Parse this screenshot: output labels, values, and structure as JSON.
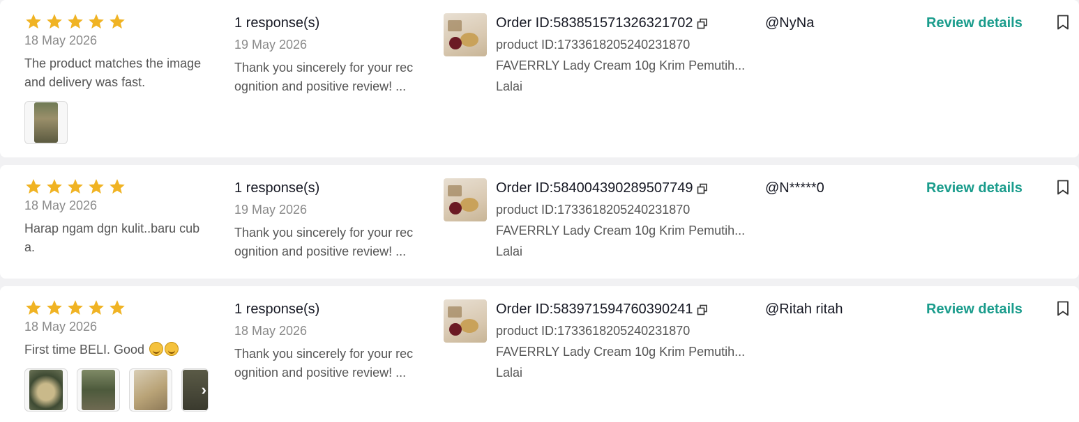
{
  "colors": {
    "star": "#f0b323",
    "accent": "#1a9c8c"
  },
  "icons": {
    "star": "star-icon",
    "copy": "copy-icon",
    "bookmark": "bookmark-icon"
  },
  "reviews": [
    {
      "rating": 5,
      "date": "18 May 2026",
      "comment": "The product matches the image and delivery was fast.",
      "photo_count": 1,
      "response_count": "1 response(s)",
      "response_date": "19 May 2026",
      "response_text": "Thank you sincerely for your rec ognition and positive review! ...",
      "order_id": "Order ID:583851571326321702",
      "product_id": "product ID:1733618205240231870",
      "product_name": "FAVERRLY Lady Cream 10g Krim Pemutih...",
      "variant": "Lalai",
      "buyer": "@NyNa",
      "review_link": "Review details"
    },
    {
      "rating": 5,
      "date": "18 May 2026",
      "comment": "Harap ngam dgn kulit..baru cub a.",
      "photo_count": 0,
      "response_count": "1 response(s)",
      "response_date": "19 May 2026",
      "response_text": "Thank you sincerely for your rec ognition and positive review! ...",
      "order_id": "Order ID:584004390289507749",
      "product_id": "product ID:1733618205240231870",
      "product_name": "FAVERRLY Lady Cream 10g Krim Pemutih...",
      "variant": "Lalai",
      "buyer": "@N*****0",
      "review_link": "Review details"
    },
    {
      "rating": 5,
      "date": "18 May 2026",
      "comment": "First time BELI. Good",
      "photo_count": 4,
      "response_count": "1 response(s)",
      "response_date": "18 May 2026",
      "response_text": "Thank you sincerely for your rec ognition and positive review! ...",
      "order_id": "Order ID:583971594760390241",
      "product_id": "product ID:1733618205240231870",
      "product_name": "FAVERRLY Lady Cream 10g Krim Pemutih...",
      "variant": "Lalai",
      "buyer": "@Ritah ritah",
      "review_link": "Review details"
    }
  ]
}
